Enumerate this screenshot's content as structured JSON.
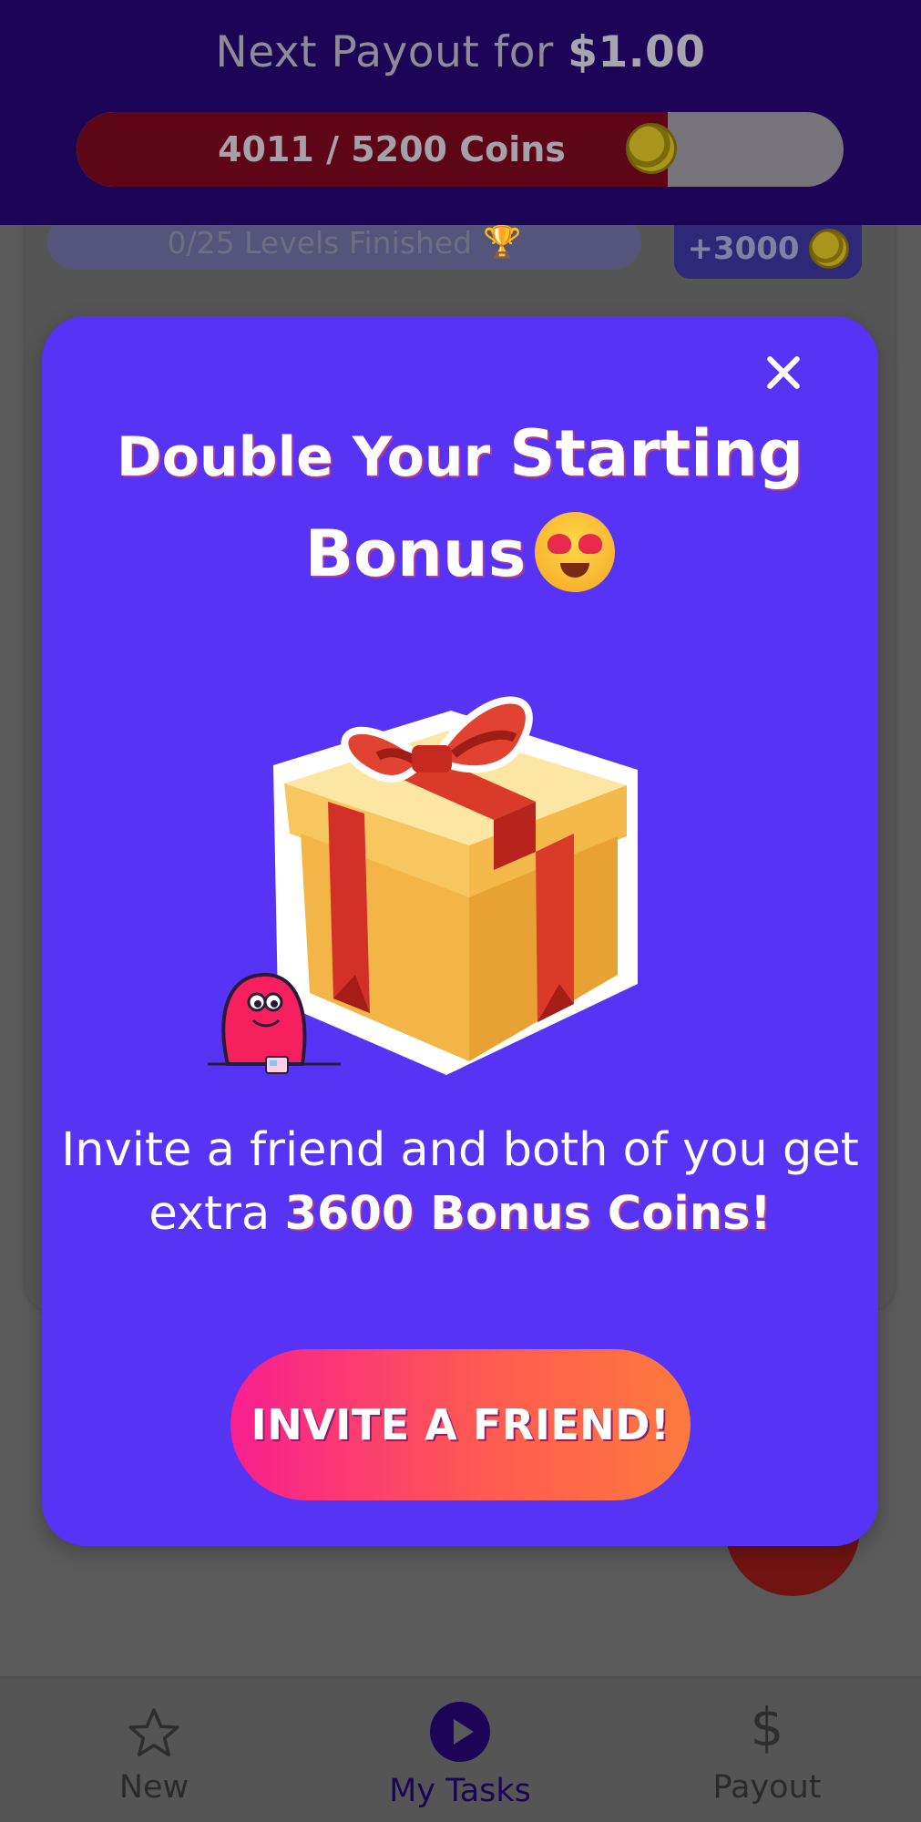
{
  "header": {
    "title_prefix": "Next Payout for ",
    "title_amount": "$1.00",
    "progress_text": "4011 / 5200 Coins",
    "progress_current": 4011,
    "progress_total": 5200
  },
  "background_card": {
    "levels_text": "0/25 Levels Finished",
    "reward_text": "+3000"
  },
  "modal": {
    "title_line1_a": "Double Your ",
    "title_line1_b": "Starting",
    "title_line2": "Bonus",
    "body_prefix": "Invite a friend and both of you get extra ",
    "body_bold": "3600 Bonus Coins!",
    "cta_label": "INVITE A FRIEND!"
  },
  "bottom_nav": {
    "items": [
      {
        "label": "New",
        "icon": "star-icon"
      },
      {
        "label": "My Tasks",
        "icon": "play-icon"
      },
      {
        "label": "Payout",
        "icon": "dollar-icon"
      }
    ],
    "active": "My Tasks"
  },
  "colors": {
    "header_bg": "#1c0457",
    "modal_bg": "#5733f5",
    "cta_gradient_start": "#f81f8f",
    "cta_gradient_end": "#fd7a3e"
  }
}
